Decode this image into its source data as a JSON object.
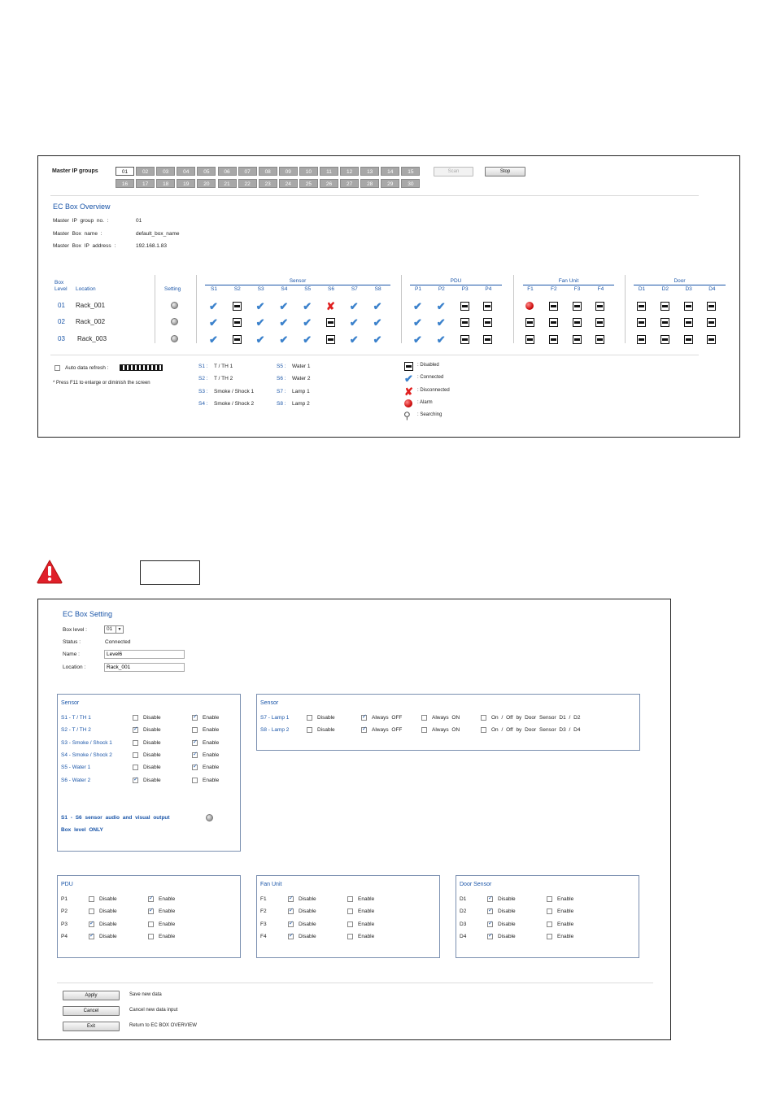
{
  "overview": {
    "master_ip_label": "Master IP groups",
    "ip_groups_row1": [
      "01",
      "02",
      "03",
      "04",
      "05",
      "06",
      "07",
      "08",
      "09",
      "10",
      "11",
      "12",
      "13",
      "14",
      "15"
    ],
    "ip_groups_row2": [
      "16",
      "17",
      "18",
      "19",
      "20",
      "21",
      "22",
      "23",
      "24",
      "25",
      "26",
      "27",
      "28",
      "29",
      "30"
    ],
    "scan_label": "Scan",
    "stop_label": "Stop",
    "title": "EC Box Overview",
    "info": [
      {
        "label": "Master IP group no. :",
        "value": "01"
      },
      {
        "label": "Master Box name :",
        "value": "default_box_name"
      },
      {
        "label": "Master Box IP address :",
        "value": "192.168.1.83"
      }
    ],
    "box_level_header": "Box\nLevel",
    "location_header": "Location",
    "setting_header": "Setting",
    "groups": {
      "sensor": "Sensor",
      "pdu": "PDU",
      "fan": "Fan Unit",
      "door": "Door"
    },
    "sensor_cols": [
      "S1",
      "S2",
      "S3",
      "S4",
      "S5",
      "S6",
      "S7",
      "S8"
    ],
    "pdu_cols": [
      "P1",
      "P2",
      "P3",
      "P4"
    ],
    "fan_cols": [
      "F1",
      "F2",
      "F3",
      "F4"
    ],
    "door_cols": [
      "D1",
      "D2",
      "D3",
      "D4"
    ],
    "rows": [
      {
        "level": "01",
        "location": "Rack_001",
        "sensor": [
          "connected",
          "disabled",
          "connected",
          "connected",
          "connected",
          "disconnected",
          "connected",
          "connected"
        ],
        "pdu": [
          "connected",
          "connected",
          "disabled",
          "disabled"
        ],
        "fan": [
          "alarm",
          "disabled",
          "disabled",
          "disabled"
        ],
        "door": [
          "disabled",
          "disabled",
          "disabled",
          "disabled"
        ]
      },
      {
        "level": "02",
        "location": "Rack_002",
        "sensor": [
          "connected",
          "disabled",
          "connected",
          "connected",
          "connected",
          "disabled",
          "connected",
          "connected"
        ],
        "pdu": [
          "connected",
          "connected",
          "disabled",
          "disabled"
        ],
        "fan": [
          "disabled",
          "disabled",
          "disabled",
          "disabled"
        ],
        "door": [
          "disabled",
          "disabled",
          "disabled",
          "disabled"
        ]
      },
      {
        "level": "03",
        "location": "Rack_003",
        "sensor": [
          "connected",
          "disabled",
          "connected",
          "connected",
          "connected",
          "disabled",
          "connected",
          "connected"
        ],
        "pdu": [
          "connected",
          "connected",
          "disabled",
          "disabled"
        ],
        "fan": [
          "disabled",
          "disabled",
          "disabled",
          "disabled"
        ],
        "door": [
          "disabled",
          "disabled",
          "disabled",
          "disabled"
        ]
      }
    ],
    "auto_refresh_label": "Auto data refresh :",
    "f11_note": "* Press F11 to enlarge or diminish the screen",
    "sensor_legend_left": [
      {
        "code": "S1",
        "name": "T / TH 1"
      },
      {
        "code": "S2",
        "name": "T / TH 2"
      },
      {
        "code": "S3",
        "name": "Smoke / Shock 1"
      },
      {
        "code": "S4",
        "name": "Smoke / Shock 2"
      }
    ],
    "sensor_legend_right": [
      {
        "code": "S5",
        "name": "Water 1"
      },
      {
        "code": "S6",
        "name": "Water 2"
      },
      {
        "code": "S7",
        "name": "Lamp 1"
      },
      {
        "code": "S8",
        "name": "Lamp 2"
      }
    ],
    "status_legend": [
      {
        "icon": "disabled",
        "label": "Disabled"
      },
      {
        "icon": "connected",
        "label": "Connected"
      },
      {
        "icon": "disconnected",
        "label": "Disconnected"
      },
      {
        "icon": "alarm",
        "label": "Alarm"
      },
      {
        "icon": "searching",
        "label": "Searching"
      }
    ]
  },
  "setting": {
    "title": "EC Box Setting",
    "box_level_label": "Box level :",
    "box_level_value": "01",
    "status_label": "Status :",
    "status_value": "Connected",
    "name_label": "Name :",
    "name_value": "Level6",
    "location_label": "Location :",
    "location_value": "Rack_001",
    "sensor_box": {
      "title": "Sensor",
      "rows": [
        {
          "code": "S1",
          "name": " - T / TH 1",
          "disable": false,
          "enable": true
        },
        {
          "code": "S2",
          "name": " - T / TH 2",
          "disable": true,
          "enable": false
        },
        {
          "code": "S3",
          "name": " - Smoke / Shock 1",
          "disable": false,
          "enable": true
        },
        {
          "code": "S4",
          "name": " - Smoke / Shock 2",
          "disable": false,
          "enable": true
        },
        {
          "code": "S5",
          "name": " - Water 1",
          "disable": false,
          "enable": true
        },
        {
          "code": "S6",
          "name": " - Water 2",
          "disable": true,
          "enable": false
        }
      ],
      "disable_label": "Disable",
      "enable_label": "Enable",
      "audio_line1": "S1 - S6 sensor audio and visual output",
      "audio_line2": "Box level ONLY"
    },
    "lamp_box": {
      "title": "Sensor",
      "rows": [
        {
          "code": "S7",
          "name": " - Lamp 1",
          "disable": false,
          "always_off": true,
          "always_on": false,
          "door": false,
          "door_label": "On / Off by Door Sensor D1 / D2"
        },
        {
          "code": "S8",
          "name": " - Lamp 2",
          "disable": false,
          "always_off": true,
          "always_on": false,
          "door": false,
          "door_label": "On / Off by Door Sensor D3 / D4"
        }
      ],
      "disable_label": "Disable",
      "always_off_label": "Always OFF",
      "always_on_label": "Always ON"
    },
    "pdu_box": {
      "title": "PDU",
      "rows": [
        {
          "code": "P1",
          "disable": false,
          "enable": true
        },
        {
          "code": "P2",
          "disable": false,
          "enable": true
        },
        {
          "code": "P3",
          "disable": true,
          "enable": false
        },
        {
          "code": "P4",
          "disable": true,
          "enable": false
        }
      ]
    },
    "fan_box": {
      "title": "Fan Unit",
      "rows": [
        {
          "code": "F1",
          "disable": true,
          "enable": false
        },
        {
          "code": "F2",
          "disable": true,
          "enable": false
        },
        {
          "code": "F3",
          "disable": true,
          "enable": false
        },
        {
          "code": "F4",
          "disable": true,
          "enable": false
        }
      ]
    },
    "door_box": {
      "title": "Door Sensor",
      "rows": [
        {
          "code": "D1",
          "disable": true,
          "enable": false
        },
        {
          "code": "D2",
          "disable": true,
          "enable": false
        },
        {
          "code": "D3",
          "disable": true,
          "enable": false
        },
        {
          "code": "D4",
          "disable": true,
          "enable": false
        }
      ]
    },
    "disable_label": "Disable",
    "enable_label": "Enable",
    "actions": [
      {
        "label": "Apply",
        "desc": "Save new data"
      },
      {
        "label": "Cancel",
        "desc": "Cancel new data input"
      },
      {
        "label": "Exit",
        "desc": "Return to EC BOX OVERVIEW"
      }
    ]
  },
  "colors": {
    "accent": "#1a55a8",
    "check": "#3c82cc",
    "alarm": "#d01010",
    "warning": "#e0202a"
  }
}
